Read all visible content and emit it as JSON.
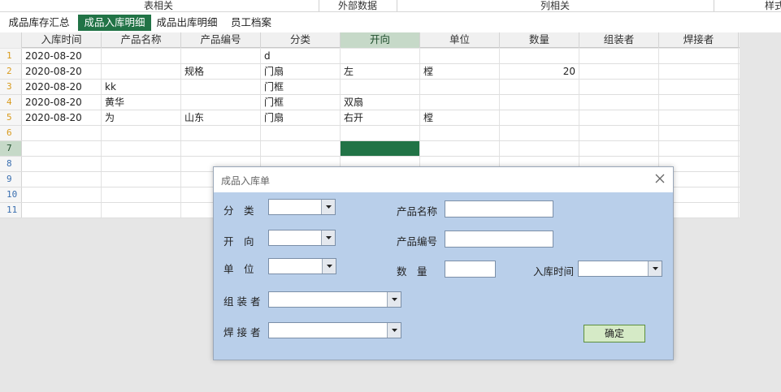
{
  "ribbon": {
    "groups": [
      "表相关",
      "外部数据",
      "列相关",
      "样式"
    ]
  },
  "tabs": [
    "成品库存汇总",
    "成品入库明细",
    "成品出库明细",
    "员工档案"
  ],
  "active_tab": 1,
  "sheet": {
    "headers": [
      "入库时间",
      "产品名称",
      "产品编号",
      "分类",
      "开向",
      "单位",
      "数量",
      "组装者",
      "焊接者"
    ],
    "selected_column": 4,
    "selected_row": 7,
    "row_numbers": [
      "1",
      "2",
      "3",
      "4",
      "5",
      "6",
      "7",
      "8",
      "9",
      "10",
      "11"
    ],
    "rows": [
      [
        "2020-08-20",
        "",
        "",
        "d",
        "",
        "",
        "",
        "",
        ""
      ],
      [
        "2020-08-20",
        "",
        "规格",
        "门扇",
        "左",
        "樘",
        "20",
        "",
        ""
      ],
      [
        "2020-08-20",
        "kk",
        "",
        "门框",
        "",
        "",
        "",
        "",
        ""
      ],
      [
        "2020-08-20",
        "黄华",
        "",
        "门框",
        "双扇",
        "",
        "",
        "",
        ""
      ],
      [
        "2020-08-20",
        "为",
        "山东",
        "门扇",
        "右开",
        "樘",
        "",
        "",
        ""
      ],
      [
        "",
        "",
        "",
        "",
        "",
        "",
        "",
        "",
        ""
      ],
      [
        "",
        "",
        "",
        "",
        "",
        "",
        "",
        "",
        ""
      ],
      [
        "",
        "",
        "",
        "",
        "",
        "",
        "",
        "",
        ""
      ],
      [
        "",
        "",
        "",
        "",
        "",
        "",
        "",
        "",
        ""
      ],
      [
        "",
        "",
        "",
        "",
        "",
        "",
        "",
        "",
        ""
      ],
      [
        "",
        "",
        "",
        "",
        "",
        "",
        "",
        "",
        ""
      ]
    ]
  },
  "dialog": {
    "title": "成品入库单",
    "labels": {
      "category": "分　类",
      "direction": "开　向",
      "unit": "单　位",
      "assembler": "组 装 者",
      "welder": "焊 接 者",
      "product_name": "产品名称",
      "product_code": "产品编号",
      "quantity": "数　量",
      "in_time": "入库时间"
    },
    "confirm_label": "确定",
    "icons": {
      "close": "close-icon",
      "dropdown": "chevron-down-icon"
    }
  }
}
